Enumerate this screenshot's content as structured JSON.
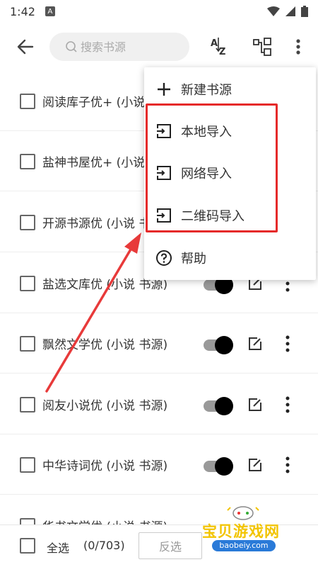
{
  "status_bar": {
    "time": "1:42",
    "badge": "A"
  },
  "toolbar": {
    "search_placeholder": "搜索书源",
    "sort_label": "A↓Z"
  },
  "sources": [
    {
      "name": "阅读库子优+ (小说 书源)"
    },
    {
      "name": "盐神书屋优+ (小说 书源)"
    },
    {
      "name": "开源书源优 (小说 书源)"
    },
    {
      "name": "盐选文库优 (小说 书源)"
    },
    {
      "name": "飘然文学优 (小说 书源)"
    },
    {
      "name": "阅友小说优 (小说 书源)"
    },
    {
      "name": "中华诗词优 (小说 书源)"
    },
    {
      "name": "华书文学优 (小说 书源)"
    }
  ],
  "bottom_bar": {
    "select_all": "全选",
    "select_count": "(0/703)",
    "invert": "反选"
  },
  "menu": {
    "new_source": "新建书源",
    "local_import": "本地导入",
    "network_import": "网络导入",
    "qr_import": "二维码导入",
    "help": "帮助"
  },
  "watermark": {
    "title": "宝贝游戏网",
    "url": "baobeiy.com"
  },
  "colors": {
    "highlight": "#e52a2a",
    "toggle_on": "#000000"
  }
}
